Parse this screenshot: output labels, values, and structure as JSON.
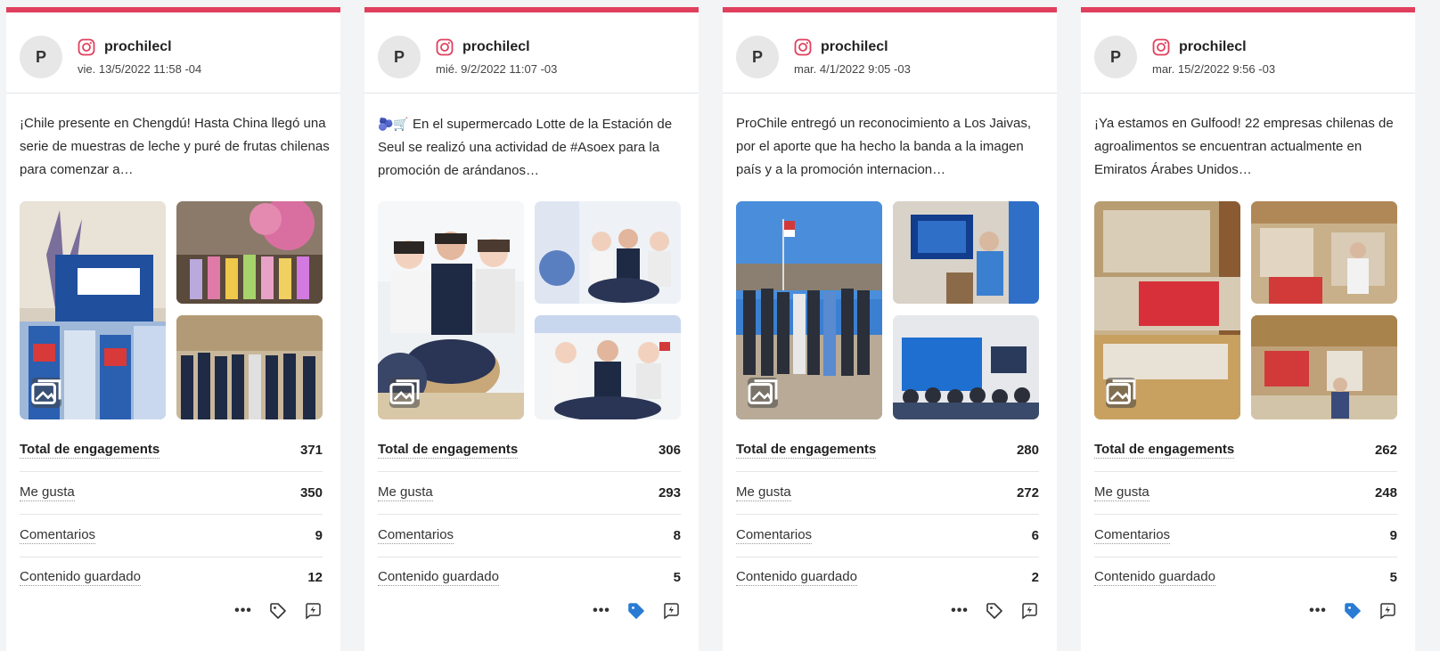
{
  "colors": {
    "accent": "#e0405e",
    "tag_active": "#2a7bd3"
  },
  "cards": [
    {
      "avatar_letter": "P",
      "account": "prochilecl",
      "network_icon": "instagram-icon",
      "date": "vie. 13/5/2022 11:58 -04",
      "text": "¡Chile presente en Chengdú! Hasta China llegó una serie de muestras de leche y puré de frutas chilenas para comenzar a…",
      "metrics": {
        "total_label": "Total de engagements",
        "total_value": "371",
        "likes_label": "Me gusta",
        "likes_value": "350",
        "comments_label": "Comentarios",
        "comments_value": "9",
        "saved_label": "Contenido guardado",
        "saved_value": "12"
      },
      "tagged": false
    },
    {
      "avatar_letter": "P",
      "account": "prochilecl",
      "network_icon": "instagram-icon",
      "date": "mié. 9/2/2022 11:07 -03",
      "emoji": "🫐🛒",
      "text": " En el supermercado Lotte de la Estación de Seul se realizó una actividad de #Asoex para la promoción de arándanos…",
      "metrics": {
        "total_label": "Total de engagements",
        "total_value": "306",
        "likes_label": "Me gusta",
        "likes_value": "293",
        "comments_label": "Comentarios",
        "comments_value": "8",
        "saved_label": "Contenido guardado",
        "saved_value": "5"
      },
      "tagged": true
    },
    {
      "avatar_letter": "P",
      "account": "prochilecl",
      "network_icon": "instagram-icon",
      "date": "mar. 4/1/2022 9:05 -03",
      "text": "ProChile entregó un reconocimiento a Los Jaivas, por el aporte que ha hecho la banda a la imagen país y a la promoción internacion…",
      "metrics": {
        "total_label": "Total de engagements",
        "total_value": "280",
        "likes_label": "Me gusta",
        "likes_value": "272",
        "comments_label": "Comentarios",
        "comments_value": "6",
        "saved_label": "Contenido guardado",
        "saved_value": "2"
      },
      "tagged": false
    },
    {
      "avatar_letter": "P",
      "account": "prochilecl",
      "network_icon": "instagram-icon",
      "date": "mar. 15/2/2022 9:56 -03",
      "text": "¡Ya estamos en Gulfood! 22 empresas chilenas de agroalimentos se encuentran actualmente en Emiratos Árabes Unidos…",
      "metrics": {
        "total_label": "Total de engagements",
        "total_value": "262",
        "likes_label": "Me gusta",
        "likes_value": "248",
        "comments_label": "Comentarios",
        "comments_value": "9",
        "saved_label": "Contenido guardado",
        "saved_value": "5"
      },
      "tagged": true
    }
  ]
}
